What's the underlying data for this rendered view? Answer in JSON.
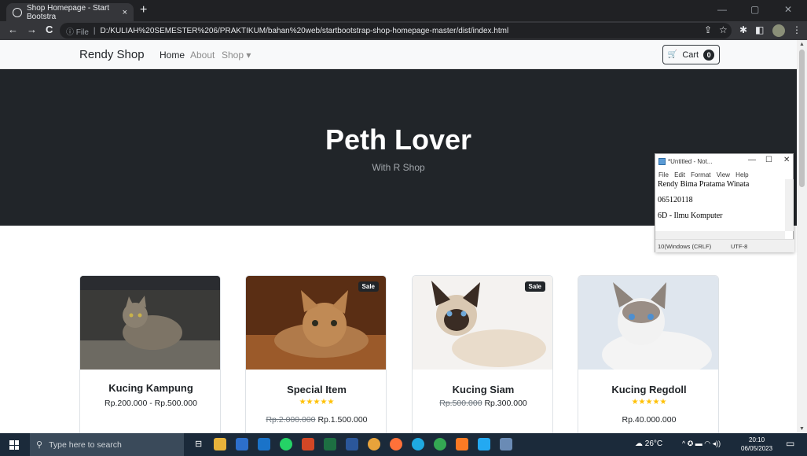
{
  "browser": {
    "tab_title": "Shop Homepage - Start Bootstra",
    "tab_close": "×",
    "new_tab": "+",
    "back": "←",
    "forward": "→",
    "reload": "C",
    "url_info": "ⓘ File",
    "url_sep": "|",
    "url": "D:/KULIAH%20SEMESTER%206/PRAKTIKUM/bahan%20web/startbootstrap-shop-homepage-master/dist/index.html",
    "minimize": "—",
    "maximize": "▢",
    "close": "✕",
    "share_icon": "⇪",
    "star_icon": "☆",
    "ext_icon": "✱",
    "sidebar_icon": "◧",
    "menu_icon": "⋮"
  },
  "site": {
    "brand": "Rendy Shop",
    "nav": {
      "home": "Home",
      "about": "About",
      "shop": "Shop ▾"
    },
    "cart": {
      "icon": "🛒",
      "label": "Cart",
      "count": "0"
    },
    "hero": {
      "title": "Peth Lover",
      "subtitle": "With R Shop"
    },
    "products": [
      {
        "name": "Kucing Kampung",
        "sale": "",
        "rating": "",
        "price": "Rp.200.000 - Rp.500.000",
        "old_price": ""
      },
      {
        "name": "Special Item",
        "sale": "Sale",
        "rating": "★★★★★",
        "price": "Rp.1.500.000",
        "old_price": "Rp.2.000.000"
      },
      {
        "name": "Kucing Siam",
        "sale": "Sale",
        "rating": "",
        "price": "Rp.300.000",
        "old_price": "Rp.500.000"
      },
      {
        "name": "Kucing Regdoll",
        "sale": "",
        "rating": "★★★★★",
        "price": "Rp.40.000.000",
        "old_price": ""
      }
    ]
  },
  "notepad": {
    "title": "*Untitled - Not...",
    "minimize": "—",
    "maximize": "☐",
    "close": "✕",
    "menu": [
      "File",
      "Edit",
      "Format",
      "View",
      "Help"
    ],
    "lines": [
      "Rendy Bima Pratama Winata",
      "065120118",
      "6D - Ilmu Komputer"
    ],
    "status": {
      "pos": "10(",
      "eol": "Windows (CRLF)",
      "enc": "UTF-8"
    }
  },
  "taskbar": {
    "search_placeholder": "Type here to search",
    "weather": "☁ 26°C",
    "tray_icons": "^ ✪ ▬ ◠ ◂))",
    "time": "20:10",
    "date": "06/05/2023",
    "notif_icon": "▭"
  },
  "colors": {
    "hero_bg": "#212529",
    "navbar_bg": "#f8f9fa",
    "star": "#ffc107",
    "taskbar": "#1b2a3a"
  }
}
